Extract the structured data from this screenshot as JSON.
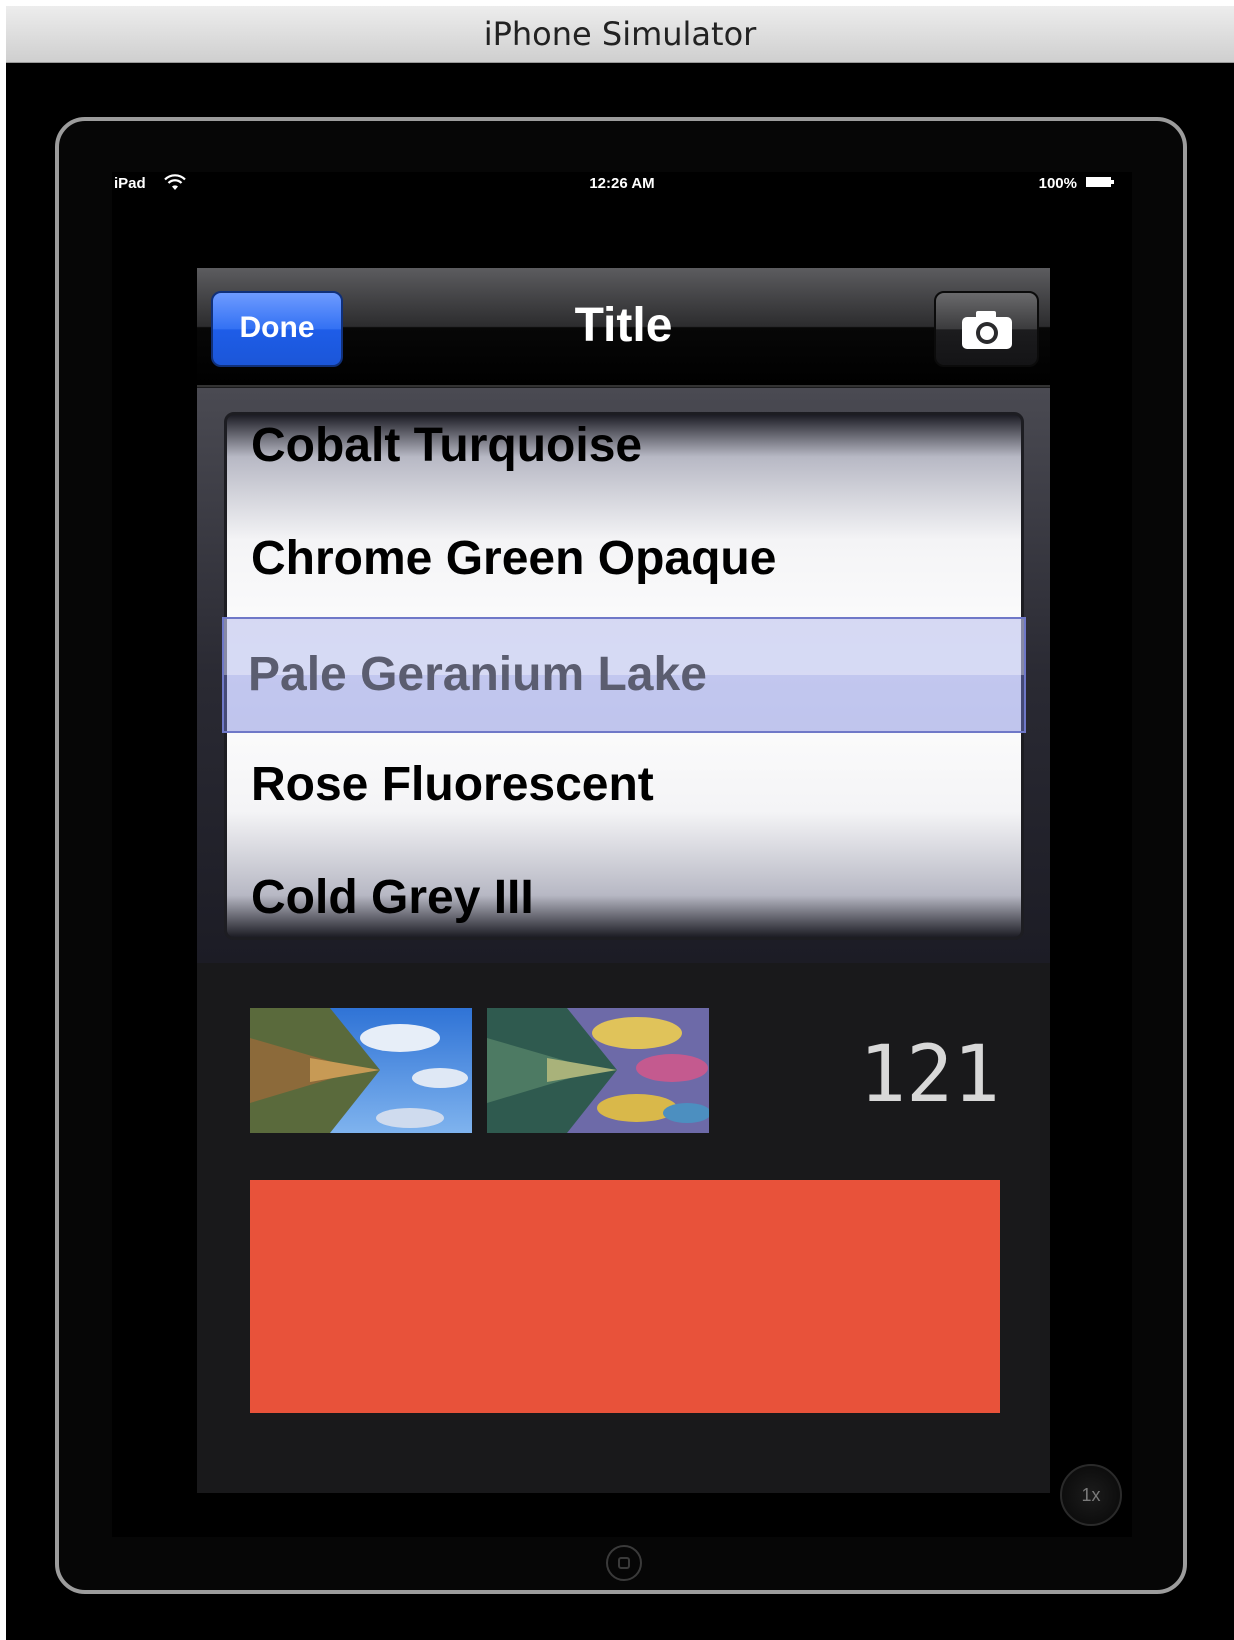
{
  "window": {
    "title": "iPhone Simulator"
  },
  "status_bar": {
    "device": "iPad",
    "time": "12:26 AM",
    "battery": "100%",
    "wifi_icon": "wifi-icon",
    "battery_icon": "battery-icon"
  },
  "nav_bar": {
    "done_label": "Done",
    "title": "Title",
    "camera_icon": "camera-icon"
  },
  "picker": {
    "rows": [
      "Cobalt Turquoise",
      "Chrome Green Opaque",
      "Pale Geranium Lake",
      "Rose Fluorescent",
      "Cold Grey III"
    ],
    "selected_index": 2,
    "selected": "Pale Geranium Lake"
  },
  "content": {
    "counter": "121",
    "swatch_color": "#e8523a"
  },
  "simulator": {
    "zoom_label": "1x"
  },
  "colors": {
    "done_button": "#2f6cf0",
    "background": "#000000",
    "popover_bg": "#19191b"
  }
}
